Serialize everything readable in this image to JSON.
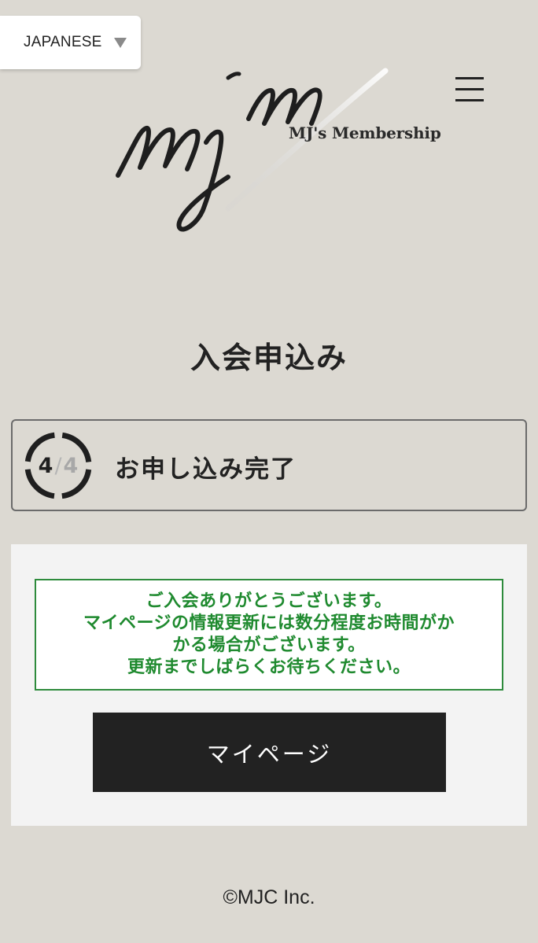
{
  "header": {
    "language_label": "JAPANESE",
    "logo_subtitle": "MJ's Membership",
    "menu_icon": "hamburger-menu-icon",
    "dropdown_icon": "triangle-down-icon"
  },
  "page": {
    "title": "入会申込み"
  },
  "step": {
    "current": "4",
    "separator": "/",
    "total": "4",
    "label": "お申し込み完了"
  },
  "notice": {
    "lines": [
      "ご入会ありがとうございます。",
      "マイページの情報更新には数分程度お時間がか",
      "かる場合がございます。",
      "更新までしばらくお待ちください。"
    ],
    "color": "#1f8a2f"
  },
  "actions": {
    "mypage_label": "マイページ"
  },
  "footer": {
    "copyright": "©MJC Inc."
  }
}
